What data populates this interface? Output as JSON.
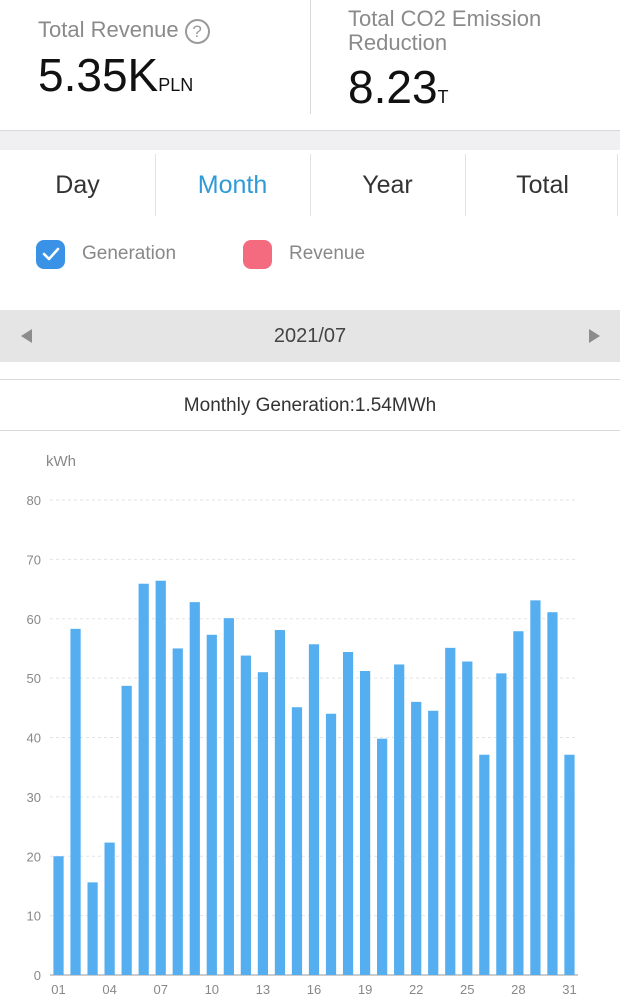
{
  "summary": {
    "revenue_label": "Total Revenue",
    "revenue_help_icon": "question-circle-icon",
    "revenue_help_glyph": "?",
    "revenue_value": "5.35K",
    "revenue_unit": "PLN",
    "co2_label": "Total CO2 Emission Reduction",
    "co2_value": "8.23",
    "co2_unit": "T"
  },
  "tabs": [
    {
      "label": "Day",
      "active": false
    },
    {
      "label": "Month",
      "active": true
    },
    {
      "label": "Year",
      "active": false
    },
    {
      "label": "Total",
      "active": false
    }
  ],
  "legend": {
    "generation_label": "Generation",
    "generation_color": "#3a92e6",
    "generation_checked": true,
    "revenue_label": "Revenue",
    "revenue_color": "#f46a7f",
    "revenue_checked": false
  },
  "date_nav": {
    "prev_icon": "triangle-left-icon",
    "date": "2021/07",
    "next_icon": "triangle-right-icon"
  },
  "monthly_summary": "Monthly Generation:1.54MWh",
  "chart_data": {
    "type": "bar",
    "ylabel": "kWh",
    "ylim": [
      0,
      80
    ],
    "yticks": [
      "0",
      "10",
      "20",
      "30",
      "40",
      "50",
      "60",
      "70",
      "80"
    ],
    "grid": true,
    "bar_color": "#55aef0",
    "categories": [
      "01",
      "02",
      "03",
      "04",
      "05",
      "06",
      "07",
      "08",
      "09",
      "10",
      "11",
      "12",
      "13",
      "14",
      "15",
      "16",
      "17",
      "18",
      "19",
      "20",
      "21",
      "22",
      "23",
      "24",
      "25",
      "26",
      "27",
      "28",
      "29",
      "30",
      "31"
    ],
    "xtick_labels": [
      "01",
      "04",
      "07",
      "10",
      "13",
      "16",
      "19",
      "22",
      "25",
      "28",
      "31"
    ],
    "values": [
      20.0,
      58.3,
      15.6,
      22.3,
      48.7,
      65.9,
      66.4,
      55.0,
      62.8,
      57.3,
      60.1,
      53.8,
      51.0,
      58.1,
      45.1,
      55.7,
      44.0,
      54.4,
      51.2,
      39.8,
      52.3,
      46.0,
      44.5,
      55.1,
      52.8,
      37.1,
      50.8,
      57.9,
      63.1,
      61.1,
      37.1
    ]
  }
}
